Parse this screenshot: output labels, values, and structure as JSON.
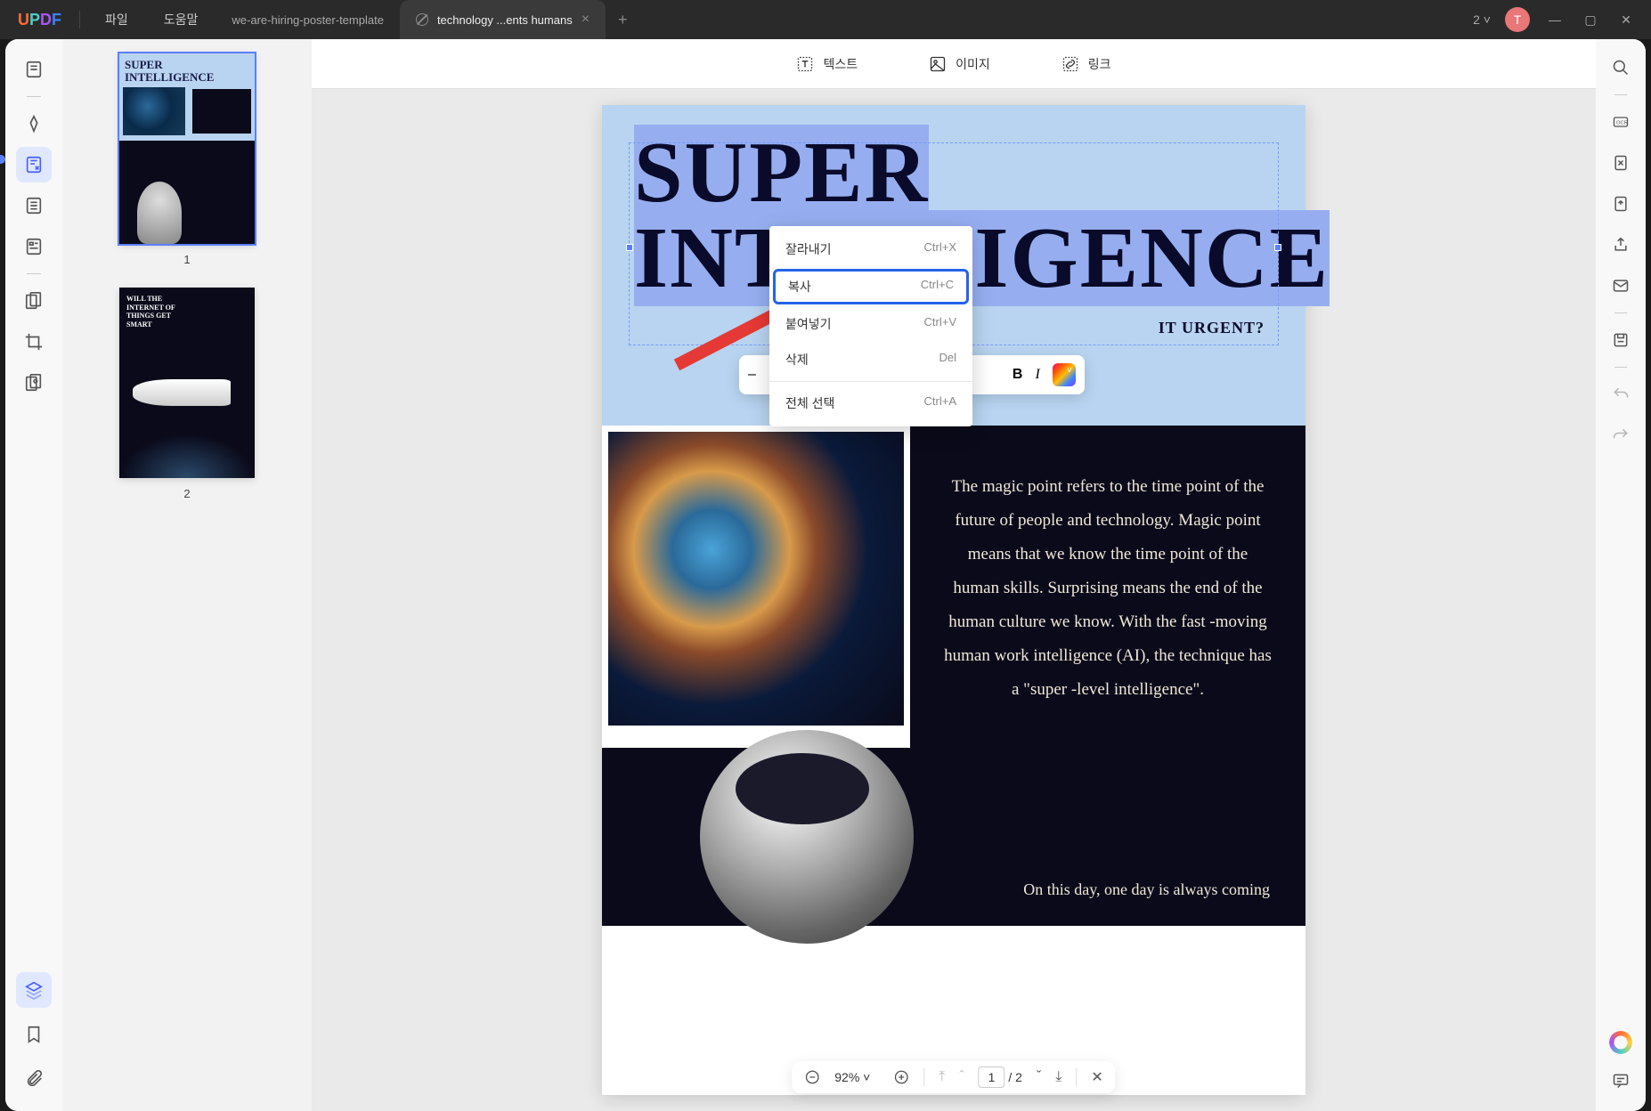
{
  "app": {
    "logo": "UPDF"
  },
  "menu": {
    "file": "파일",
    "help": "도움말"
  },
  "tabs": [
    {
      "label": "we-are-hiring-poster-template",
      "active": false
    },
    {
      "label": "technology ...ents humans",
      "active": true
    }
  ],
  "tab_count": "2",
  "avatar_letter": "T",
  "toolbar": {
    "text": "텍스트",
    "image": "이미지",
    "link": "링크"
  },
  "thumbnails": [
    {
      "num": "1",
      "title": "SUPER INTELLIGENCE"
    },
    {
      "num": "2",
      "title": "WILL THE INTERNET OF THINGS GET SMART"
    }
  ],
  "document": {
    "title_line1": "SUPER",
    "title_line2": "INTELLIGENCE",
    "subtitle_suffix": "IT URGENT?",
    "body": "The magic point refers to the time point of the future of people and technology. Magic point means that we know the time point of the human skills. Surprising means the end of the human culture we know. With the fast -moving human work intelligence (AI), the technique has a \"super -level intelligence\".",
    "footer_line": "On this day, one day is always coming"
  },
  "context_menu": {
    "cut": {
      "label": "잘라내기",
      "shortcut": "Ctrl+X"
    },
    "copy": {
      "label": "복사",
      "shortcut": "Ctrl+C"
    },
    "paste": {
      "label": "붙여넣기",
      "shortcut": "Ctrl+V"
    },
    "delete": {
      "label": "삭제",
      "shortcut": "Del"
    },
    "select_all": {
      "label": "전체 선택",
      "shortcut": "Ctrl+A"
    }
  },
  "format_bar": {
    "dash": "–",
    "bold": "B",
    "italic": "I"
  },
  "zoom": {
    "level": "92%",
    "page_current": "1",
    "page_sep": "/",
    "page_total": "2"
  }
}
